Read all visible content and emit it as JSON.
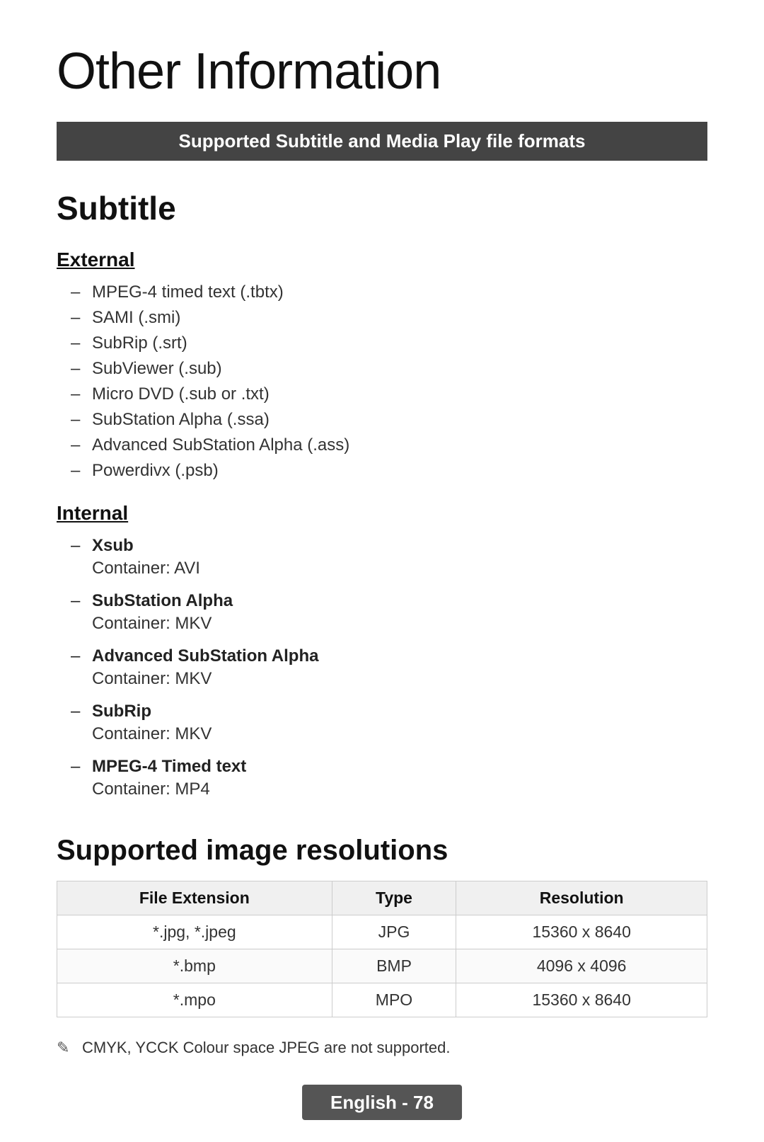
{
  "page": {
    "title": "Other Information",
    "section_bar": "Supported Subtitle and Media Play file formats",
    "subtitle_section": {
      "title": "Subtitle",
      "external": {
        "label": "External",
        "items": [
          "MPEG-4 timed text (.tbtx)",
          "SAMI (.smi)",
          "SubRip (.srt)",
          "SubViewer (.sub)",
          "Micro DVD (.sub or .txt)",
          "SubStation Alpha (.ssa)",
          "Advanced SubStation Alpha (.ass)",
          "Powerdivx (.psb)"
        ]
      },
      "internal": {
        "label": "Internal",
        "items": [
          {
            "title": "Xsub",
            "desc": "Container: AVI"
          },
          {
            "title": "SubStation Alpha",
            "desc": "Container: MKV"
          },
          {
            "title": "Advanced SubStation Alpha",
            "desc": "Container: MKV"
          },
          {
            "title": "SubRip",
            "desc": "Container: MKV"
          },
          {
            "title": "MPEG-4 Timed text",
            "desc": "Container: MP4"
          }
        ]
      }
    },
    "image_resolution_section": {
      "title": "Supported image resolutions",
      "table": {
        "headers": [
          "File Extension",
          "Type",
          "Resolution"
        ],
        "rows": [
          [
            "*.jpg, *.jpeg",
            "JPG",
            "15360 x 8640"
          ],
          [
            "*.bmp",
            "BMP",
            "4096 x 4096"
          ],
          [
            "*.mpo",
            "MPO",
            "15360 x 8640"
          ]
        ]
      },
      "note": "CMYK, YCCK Colour space JPEG are not supported."
    },
    "footer": {
      "page_label": "English - 78"
    }
  }
}
